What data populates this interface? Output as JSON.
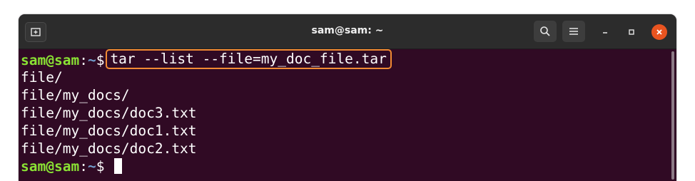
{
  "window": {
    "title": "sam@sam: ~"
  },
  "colors": {
    "terminal_bg": "#300a24",
    "titlebar_bg": "#2c2c2c",
    "user_host": "#8ae234",
    "path": "#729fcf",
    "highlight_border": "#f28a33",
    "close_button": "#e95420"
  },
  "icons": {
    "new_tab": "new-tab-icon",
    "search": "search-icon",
    "menu": "hamburger-menu-icon",
    "minimize": "minimize-icon",
    "maximize": "maximize-icon",
    "close": "close-icon"
  },
  "terminal": {
    "prompt1": {
      "userhost": "sam@sam",
      "colon": ":",
      "path": "~",
      "symbol": "$",
      "command": "tar --list --file=my_doc_file.tar"
    },
    "output": [
      "file/",
      "file/my_docs/",
      "file/my_docs/doc3.txt",
      "file/my_docs/doc1.txt",
      "file/my_docs/doc2.txt"
    ],
    "prompt2": {
      "userhost": "sam@sam",
      "colon": ":",
      "path": "~",
      "symbol": "$ "
    }
  }
}
